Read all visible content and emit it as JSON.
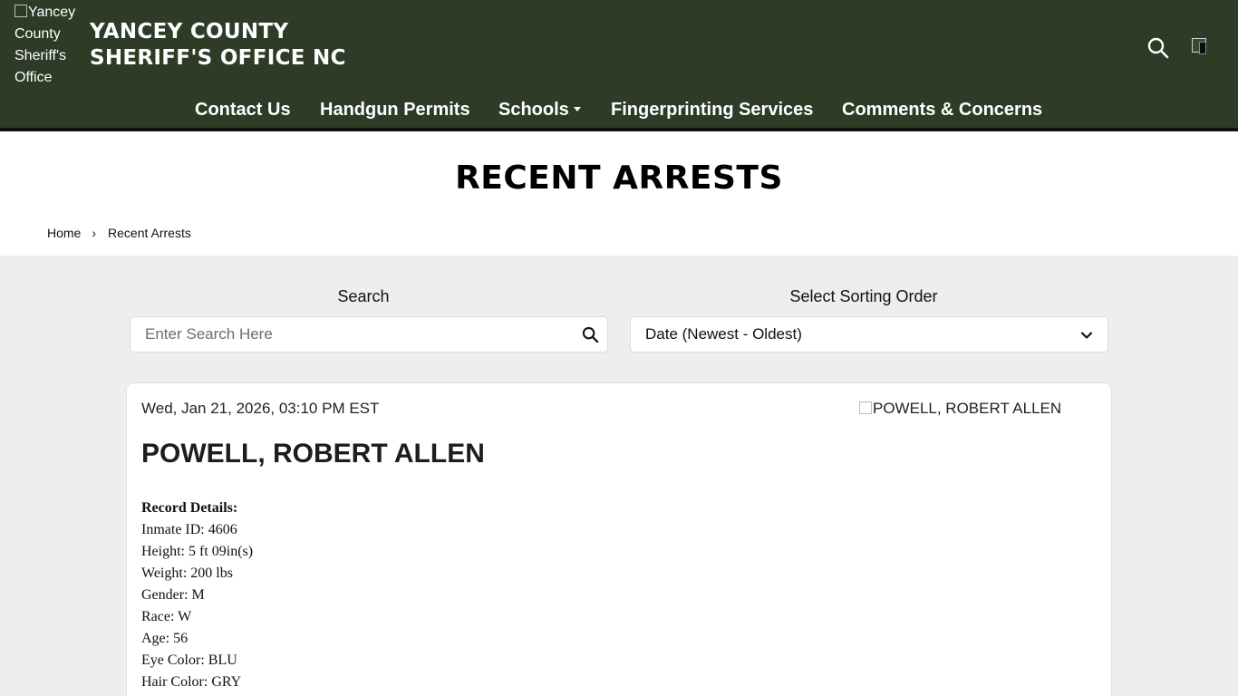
{
  "header": {
    "logo_alt": "Yancey County Sheriff's Office",
    "title_line1": "YANCEY COUNTY",
    "title_line2": "SHERIFF'S OFFICE NC",
    "background_color": "#2d3b27"
  },
  "nav": {
    "items": [
      {
        "label": "Contact Us"
      },
      {
        "label": "Handgun Permits"
      },
      {
        "label": "Schools",
        "has_dropdown": true
      },
      {
        "label": "Fingerprinting Services"
      },
      {
        "label": "Comments & Concerns"
      }
    ]
  },
  "page": {
    "title": "RECENT ARRESTS"
  },
  "breadcrumb": {
    "home": "Home",
    "separator": "›",
    "current": "Recent Arrests"
  },
  "filters": {
    "search_label": "Search",
    "search_placeholder": "Enter Search Here",
    "sort_label": "Select Sorting Order",
    "sort_value": "Date (Newest - Oldest)"
  },
  "record": {
    "date": "Wed, Jan 21, 2026, 03:10 PM EST",
    "photo_alt": "POWELL, ROBERT ALLEN",
    "name": "POWELL, ROBERT ALLEN",
    "details_heading": "Record Details:",
    "details": [
      "Inmate ID: 4606",
      "Height: 5 ft 09in(s)",
      "Weight: 200 lbs",
      "Gender: M",
      "Race: W",
      "Age: 56",
      "Eye Color: BLU",
      "Hair Color: GRY"
    ]
  },
  "icons": {
    "search": "search-icon",
    "account": "broken-image-icon",
    "dropdown": "chevron-down-icon"
  }
}
